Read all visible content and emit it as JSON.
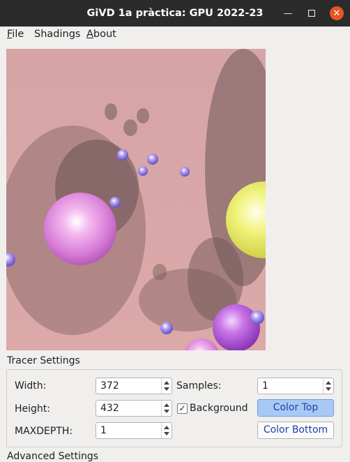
{
  "window": {
    "title": "GiVD 1a pràctica: GPU 2022-23"
  },
  "menu": {
    "file": "File",
    "shadings": "Shadings",
    "about": "About"
  },
  "tracer": {
    "section_label": "Tracer Settings",
    "width_label": "Width:",
    "width_value": "372",
    "height_label": "Height:",
    "height_value": "432",
    "maxdepth_label": "MAXDEPTH:",
    "maxdepth_value": "1",
    "samples_label": "Samples:",
    "samples_value": "1",
    "background_label": "Background",
    "background_checked": true,
    "color_top_label": "Color Top",
    "color_bottom_label": "Color Bottom"
  },
  "advanced": {
    "section_label": "Advanced Settings"
  },
  "colors": {
    "titlebar": "#2b2b2b",
    "close": "#e95420",
    "render_bg": "#d7a5a5",
    "accent": "#a9c8f5"
  }
}
